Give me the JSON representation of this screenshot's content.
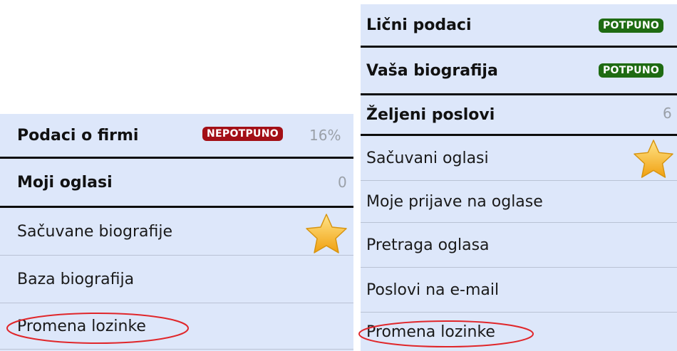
{
  "left_menu": {
    "company_data": {
      "label": "Podaci o firmi",
      "badge": "NEPOTPUNO",
      "percent": "16%"
    },
    "my_ads": {
      "label": "Moji oglasi",
      "count": "0"
    },
    "saved_cvs": {
      "label": "Sačuvane biografije",
      "icon": "star-icon"
    },
    "cv_database": {
      "label": "Baza biografija"
    },
    "change_password": {
      "label": "Promena lozinke"
    }
  },
  "right_menu": {
    "personal_data": {
      "label": "Lični podaci",
      "badge": "POTPUNO"
    },
    "your_cv": {
      "label": "Vaša biografija",
      "badge": "POTPUNO"
    },
    "desired_jobs": {
      "label": "Željeni poslovi",
      "count": "6"
    },
    "saved_ads": {
      "label": "Sačuvani oglasi",
      "icon": "star-icon"
    },
    "my_applications": {
      "label": "Moje prijave na oglase"
    },
    "job_search": {
      "label": "Pretraga oglasa"
    },
    "jobs_by_email": {
      "label": "Poslovi na e-mail"
    },
    "change_password": {
      "label": "Promena lozinke"
    }
  },
  "colors": {
    "panel_bg": "#dde7fa",
    "badge_incomplete": "#a30f16",
    "badge_complete": "#1e6b12",
    "highlight_ellipse": "#e0262a",
    "star": "#f6b51a"
  }
}
